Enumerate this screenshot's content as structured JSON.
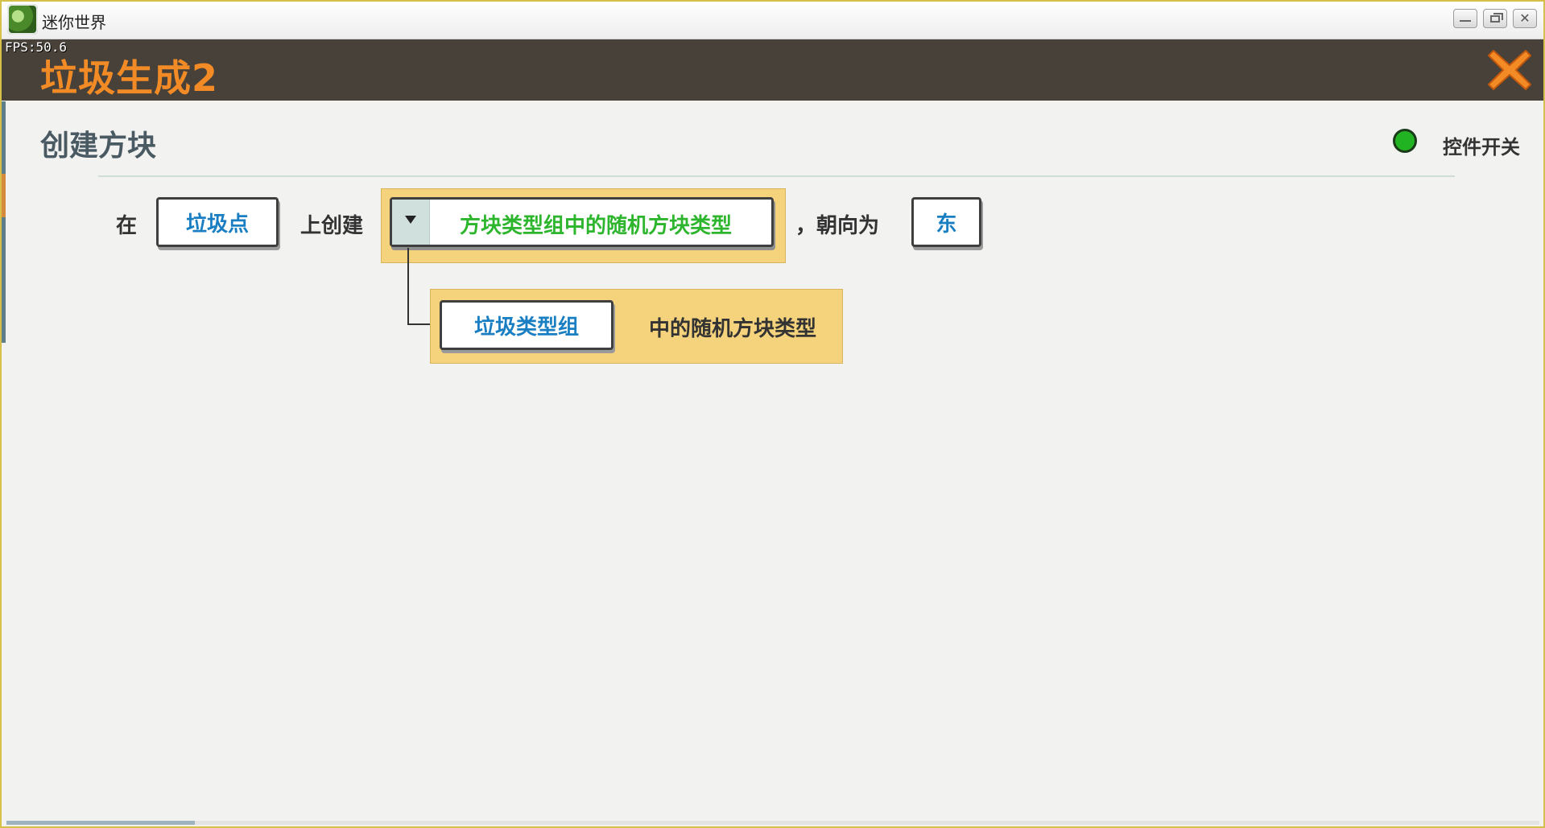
{
  "os_window": {
    "title": "迷你世界",
    "icon": "mini-world-app-icon"
  },
  "header": {
    "fps": "FPS:50.6",
    "title": "垃圾生成2",
    "close_icon": "close-x-icon",
    "accent_color": "#f28b26"
  },
  "section": {
    "title": "创建方块",
    "switch_label": "控件开关",
    "switch_state": "on",
    "switch_color": "#22b322"
  },
  "statement": {
    "word_at": "在",
    "location_param": "垃圾点",
    "word_create": "上创建",
    "block_dropdown": "方块类型组中的随机方块类型",
    "word_facing": "，朝向为",
    "direction_param": "东"
  },
  "sub_block": {
    "group_param": "垃圾类型组",
    "suffix": "中的随机方块类型"
  }
}
